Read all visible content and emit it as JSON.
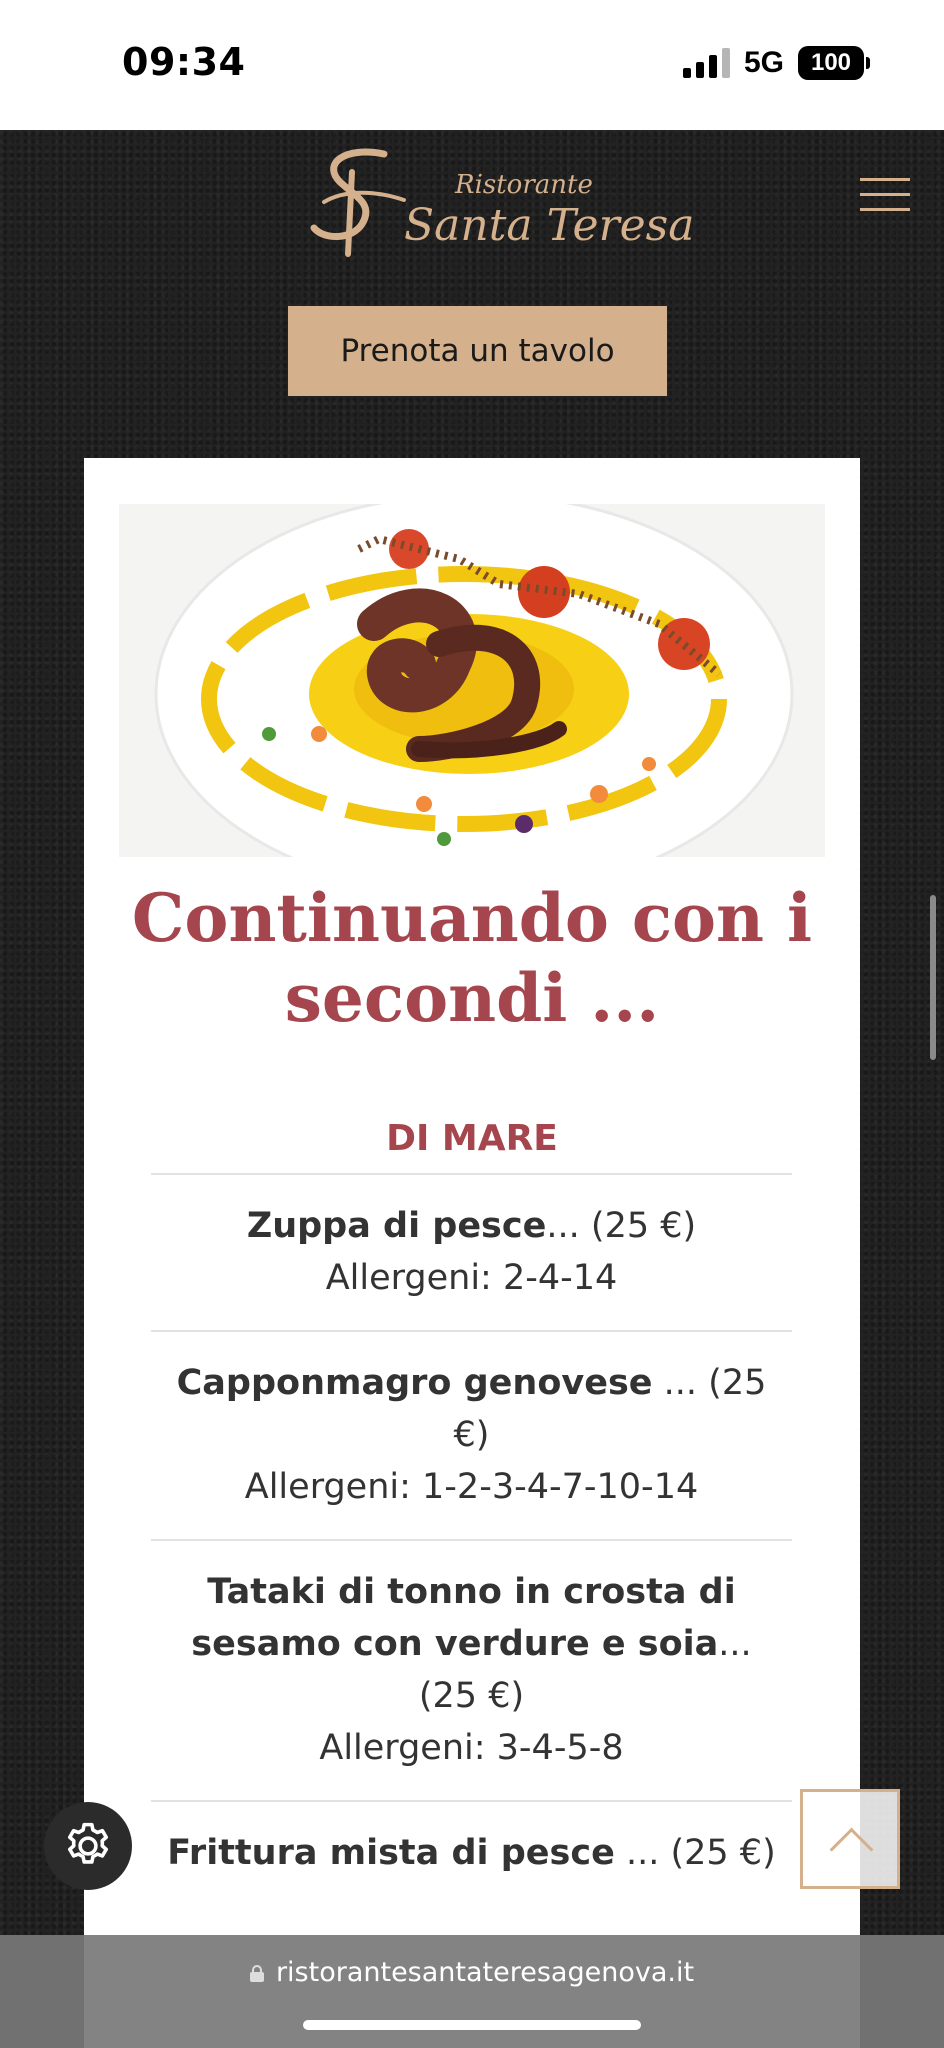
{
  "status_bar": {
    "time": "09:34",
    "network": "5G",
    "battery": "100"
  },
  "header": {
    "logo_small": "Ristorante",
    "logo_name": "Santa Teresa",
    "logo_monogram": "ST",
    "menu_icon": "hamburger-icon",
    "book_button": "Prenota un tavolo"
  },
  "content": {
    "photo_description": "octopus dish plate",
    "section_title": "Continuando con i secondi ...",
    "sub_title": "DI MARE",
    "items": [
      {
        "name": "Zuppa di pesce",
        "dots": "...",
        "price": "(25 €)",
        "allergens": "Allergeni: 2-4-14"
      },
      {
        "name": "Capponmagro genovese",
        "dots": " ...",
        "price": "(25 €)",
        "allergens": "Allergeni: 1-2-3-4-7-10-14"
      },
      {
        "name": "Tataki di tonno in crosta di sesamo con verdure e soia",
        "dots": "...",
        "price": "(25 €)",
        "allergens": "Allergeni: 3-4-5-8"
      },
      {
        "name": "Frittura mista di pesce",
        "dots": " ...",
        "price": "(25 €)",
        "allergens": ""
      }
    ]
  },
  "floating": {
    "scroll_top_icon": "chevron-up-icon",
    "settings_icon": "gear-icon"
  },
  "browser": {
    "url": "ristorantesantateresagenova.it"
  },
  "colors": {
    "accent": "#d4b08c",
    "title": "#a5454d",
    "background": "#222222"
  }
}
